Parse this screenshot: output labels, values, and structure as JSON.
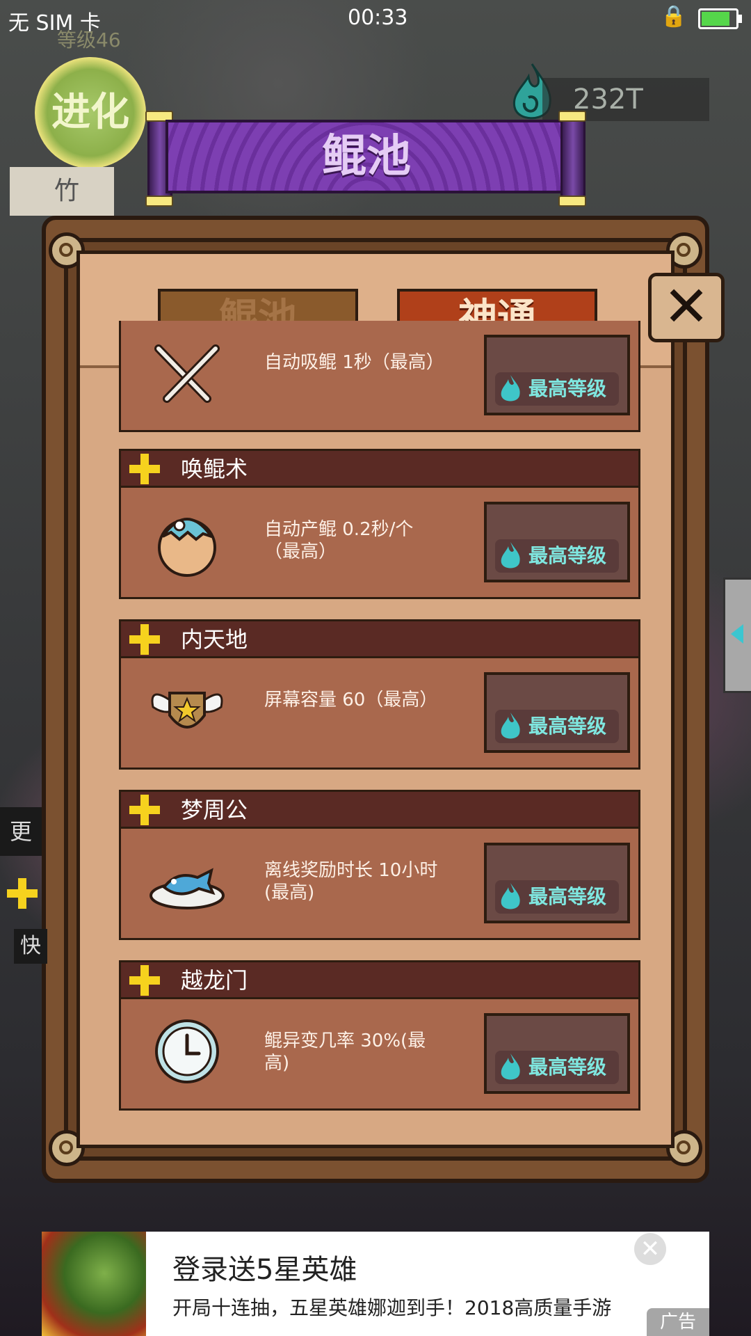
{
  "status_bar": {
    "sim": "无 SIM 卡",
    "time": "00:33",
    "battery_level": 0.9
  },
  "hud": {
    "level": "等级46",
    "evolve_label": "进化",
    "side_label": "竹",
    "currency": "232T",
    "side_edge_label": "更",
    "side_quick_label": "快"
  },
  "title": "鲲池",
  "tabs": [
    {
      "label": "鲲池",
      "active": false
    },
    {
      "label": "神通",
      "active": true
    }
  ],
  "close_symbol": "✕",
  "abilities": [
    {
      "name": "",
      "description": "自动吸鲲 1秒（最高）",
      "button": "最高等级",
      "icon": "crossed-swords-icon"
    },
    {
      "name": "唤鲲术",
      "description": "自动产鲲 0.2秒/个（最高）",
      "button": "最高等级",
      "icon": "hatching-egg-icon"
    },
    {
      "name": "内天地",
      "description": "屏幕容量 60（最高）",
      "button": "最高等级",
      "icon": "winged-shield-icon"
    },
    {
      "name": "梦周公",
      "description": "离线奖励时长 10小时(最高)",
      "button": "最高等级",
      "icon": "fish-plate-icon"
    },
    {
      "name": "越龙门",
      "description": "鲲异变几率 30%(最高)",
      "button": "最高等级",
      "icon": "clock-icon"
    }
  ],
  "ad": {
    "title": "登录送5星英雄",
    "description": "开局十连抽，五星英雄娜迦到手！2018高质量手游",
    "tag": "广告",
    "close": "✕"
  },
  "colors": {
    "accent_teal": "#7fe7e0",
    "banner_purple": "#7d3fb2",
    "tab_active": "#b0401a",
    "plus_yellow": "#f6d21e"
  }
}
